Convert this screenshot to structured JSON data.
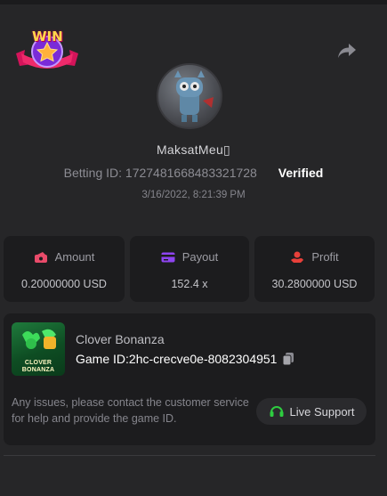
{
  "badge": {
    "text": "WIN"
  },
  "user": {
    "name": "MaksatMeu▯",
    "betting_id": "Betting ID: 1727481668483321728",
    "status": "Verified",
    "timestamp": "3/16/2022, 8:21:39 PM"
  },
  "stats": [
    {
      "icon": "money-icon",
      "label": "Amount",
      "value": "0.20000000 USD"
    },
    {
      "icon": "card-icon",
      "label": "Payout",
      "value": "152.4 x"
    },
    {
      "icon": "hand-money-icon",
      "label": "Profit",
      "value": "30.2800000 USD"
    }
  ],
  "game": {
    "thumb_line1": "CLOVER",
    "thumb_line2": "BONANZA",
    "name": "Clover Bonanza",
    "id": "Game ID:2hc-crecve0e-8082304951"
  },
  "support": {
    "help_text": "Any issues, please contact the customer service for help and provide the game ID.",
    "button_label": "Live Support"
  },
  "colors": {
    "background": "#262628",
    "card": "#1c1c1e",
    "accent_green": "#2ecc40",
    "amount_icon": "#e94b6a",
    "payout_icon": "#8e44f0",
    "profit_icon": "#e8403a"
  }
}
